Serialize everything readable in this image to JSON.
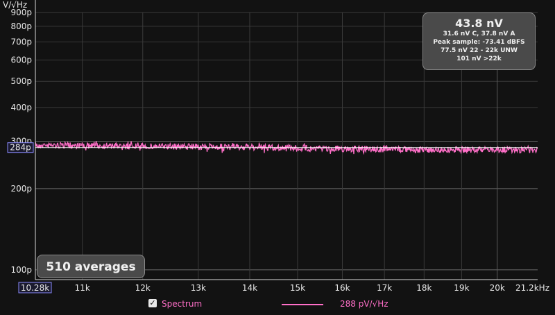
{
  "chart_data": {
    "type": "line",
    "ylabel": "V/√Hz",
    "y_scale": "log",
    "ylim": [
      9.2e-11,
      9e-10
    ],
    "xlim": [
      10280,
      21200
    ],
    "y_ticks": [
      {
        "value": 9e-10,
        "label": "900p"
      },
      {
        "value": 8e-10,
        "label": "800p"
      },
      {
        "value": 7e-10,
        "label": "700p"
      },
      {
        "value": 6e-10,
        "label": "600p"
      },
      {
        "value": 5e-10,
        "label": "500p"
      },
      {
        "value": 4e-10,
        "label": "400p"
      },
      {
        "value": 3e-10,
        "label": "300p"
      },
      {
        "value": 2e-10,
        "label": "200p"
      },
      {
        "value": 1e-10,
        "label": "100p"
      }
    ],
    "x_ticks": [
      {
        "value": 10280,
        "label": "10.28k"
      },
      {
        "value": 11000,
        "label": "11k"
      },
      {
        "value": 12000,
        "label": "12k"
      },
      {
        "value": 13000,
        "label": "13k"
      },
      {
        "value": 14000,
        "label": "14k"
      },
      {
        "value": 15000,
        "label": "15k"
      },
      {
        "value": 16000,
        "label": "16k"
      },
      {
        "value": 17000,
        "label": "17k"
      },
      {
        "value": 18000,
        "label": "18k"
      },
      {
        "value": 19000,
        "label": "19k"
      },
      {
        "value": 20000,
        "label": "20k"
      },
      {
        "value": 21200,
        "label": "21.2kHz"
      }
    ],
    "cursor": {
      "value": 2.84e-10,
      "label": "284p"
    },
    "series": [
      {
        "name": "Spectrum",
        "color": "#ff6fc8",
        "x": [
          10280,
          11000,
          12000,
          13000,
          14000,
          15000,
          16000,
          17000,
          18000,
          19000,
          20000,
          21200
        ],
        "y": [
          2.9e-10,
          2.89e-10,
          2.87e-10,
          2.86e-10,
          2.85e-10,
          2.83e-10,
          2.81e-10,
          2.8e-10,
          2.79e-10,
          2.79e-10,
          2.79e-10,
          2.78e-10
        ]
      }
    ]
  },
  "stats": {
    "main": "43.8 nV",
    "lines": [
      "31.6 nV C, 37.8 nV A",
      "Peak sample: -73.41 dBFS",
      "77.5 nV 22 - 22k UNW",
      "101 nV >22k"
    ]
  },
  "averages_label": "510 averages",
  "legend": {
    "checkbox_mark": "✓",
    "series_label": "Spectrum",
    "value_label": "288 pV/√Hz"
  }
}
